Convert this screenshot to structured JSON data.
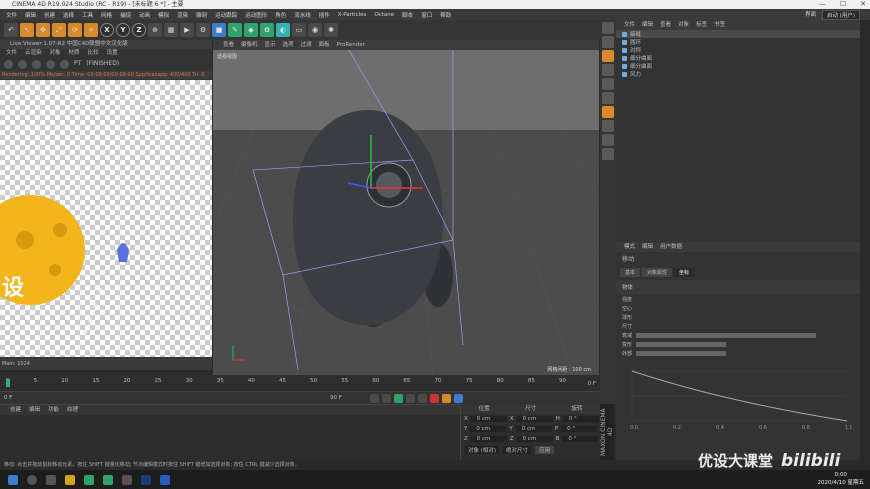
{
  "window": {
    "title": "CINEMA 4D R19.024 Studio (RC - R19) - [未标题 6 *] - 主要"
  },
  "menubar": {
    "items": [
      "文件",
      "编辑",
      "创建",
      "选择",
      "工具",
      "网格",
      "捕捉",
      "动画",
      "模拟",
      "渲染",
      "雕刻",
      "运动跟踪",
      "运动图形",
      "角色",
      "流水线",
      "插件",
      "X-Particles",
      "Octane",
      "脚本",
      "窗口",
      "帮助"
    ],
    "layout_label": "界面",
    "layout_value": "启动 (用户)"
  },
  "liveviewer": {
    "title": "Live Viewer 1.07-R2 中国C4D联盟中文汉化版",
    "menu": [
      "文件",
      "云渲染",
      "对象",
      "材质",
      "比较",
      "设置"
    ],
    "status_tag": "(FINISHED)",
    "mode": "PT",
    "status_text": "Rendering: 100%   Ms/sec: 0   Time: 00:00:00/00:00:00   Spp/maxspp: 400/400   Tri: 0",
    "footer": "Main: 1024"
  },
  "viewport": {
    "menu": [
      "查看",
      "摄像机",
      "显示",
      "选项",
      "过滤",
      "面板",
      "ProRender"
    ],
    "label": "透视视图",
    "grid": "网格间距 : 100 cm"
  },
  "timeline": {
    "ticks": [
      "0",
      "5",
      "10",
      "15",
      "20",
      "25",
      "30",
      "35",
      "40",
      "45",
      "50",
      "55",
      "60",
      "65",
      "70",
      "75",
      "80",
      "85",
      "90"
    ],
    "current": "0 F",
    "start": "0 F",
    "end": "90 F"
  },
  "bottom": {
    "menu": [
      "创建",
      "编辑",
      "功能",
      "纹理"
    ]
  },
  "coords": {
    "headers": [
      "位置",
      "尺寸",
      "旋转"
    ],
    "rows": [
      [
        "X",
        "0 cm",
        "X",
        "0 cm",
        "H",
        "0 °"
      ],
      [
        "Y",
        "0 cm",
        "Y",
        "0 cm",
        "P",
        "0 °"
      ],
      [
        "Z",
        "0 cm",
        "Z",
        "0 cm",
        "B",
        "0 °"
      ]
    ],
    "mode": "对象 (相对)",
    "size_mode": "绝对尺寸",
    "apply": "应用"
  },
  "maxon": "MAXON CINEMA 4D",
  "objects": {
    "menu": [
      "文件",
      "编辑",
      "查看",
      "对象",
      "标签",
      "书签"
    ],
    "rows": [
      "接缝",
      "圆环",
      "对称",
      "细分曲面",
      "细分曲面",
      "风力"
    ]
  },
  "attributes": {
    "menu": [
      "模式",
      "编辑",
      "用户数据"
    ],
    "title": "移动",
    "tabs": [
      "基本",
      "对象属性",
      "坐标"
    ],
    "section": "物体",
    "rows": [
      "强度",
      "空心",
      "球形",
      "尺寸",
      "衰减",
      "变形",
      "外部"
    ],
    "chart_ticks": [
      "0.0",
      "0.2",
      "0.4",
      "0.6",
      "0.8",
      "1.0"
    ]
  },
  "statusline": "移动: 点击并拖动鼠标移动元素。按住 SHIFT 键量化移动; 节点编辑模式时按住 SHIFT 键增加选择对象; 按住 CTRL 键减少选择对象。",
  "taskbar": {
    "time": "0:00",
    "date": "2020/4/10 星期五"
  },
  "watermark": {
    "text": "优设大课堂",
    "logo": "bilibili"
  }
}
